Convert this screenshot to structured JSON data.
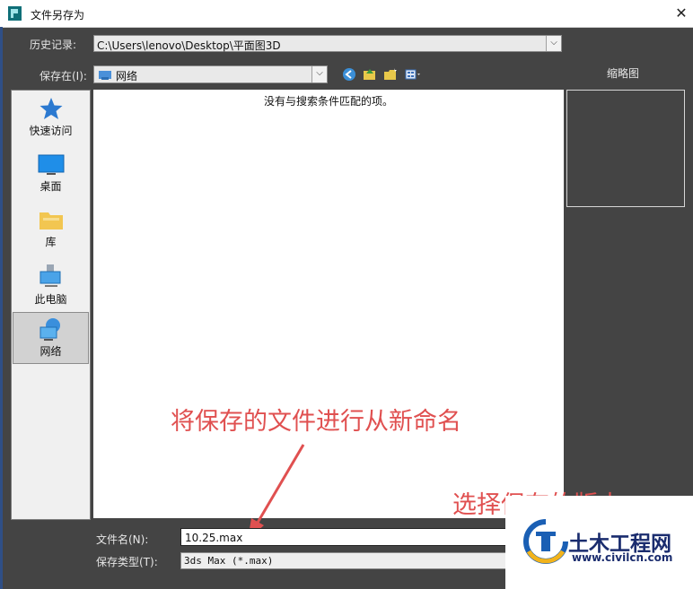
{
  "window": {
    "title": "文件另存为",
    "close_glyph": "✕"
  },
  "history": {
    "label": "历史记录:",
    "value": "C:\\Users\\lenovo\\Desktop\\平面图3D"
  },
  "save_in": {
    "label": "保存在(I):",
    "value": "网络"
  },
  "thumbnail": {
    "label": "缩略图"
  },
  "places": [
    {
      "label": "快速访问",
      "icon": "star-icon"
    },
    {
      "label": "桌面",
      "icon": "desktop-icon"
    },
    {
      "label": "库",
      "icon": "library-icon"
    },
    {
      "label": "此电脑",
      "icon": "computer-icon"
    },
    {
      "label": "网络",
      "icon": "network-icon",
      "selected": true
    }
  ],
  "file_list": {
    "empty_message": "没有与搜索条件匹配的项。"
  },
  "filename": {
    "label": "文件名(N):",
    "value": "10.25.max"
  },
  "filetype": {
    "label": "保存类型(T):",
    "value": "3ds Max (*.max)"
  },
  "annotations": {
    "rename_note": "将保存的文件进行从新命名",
    "version_note": "选择保存的版本"
  },
  "watermark": {
    "name": "土木工程网",
    "url": "www.civilcn.com"
  },
  "colors": {
    "annotation": "#e05050",
    "dialog_bg": "#444444",
    "watermark_text": "#1a2c6e"
  }
}
